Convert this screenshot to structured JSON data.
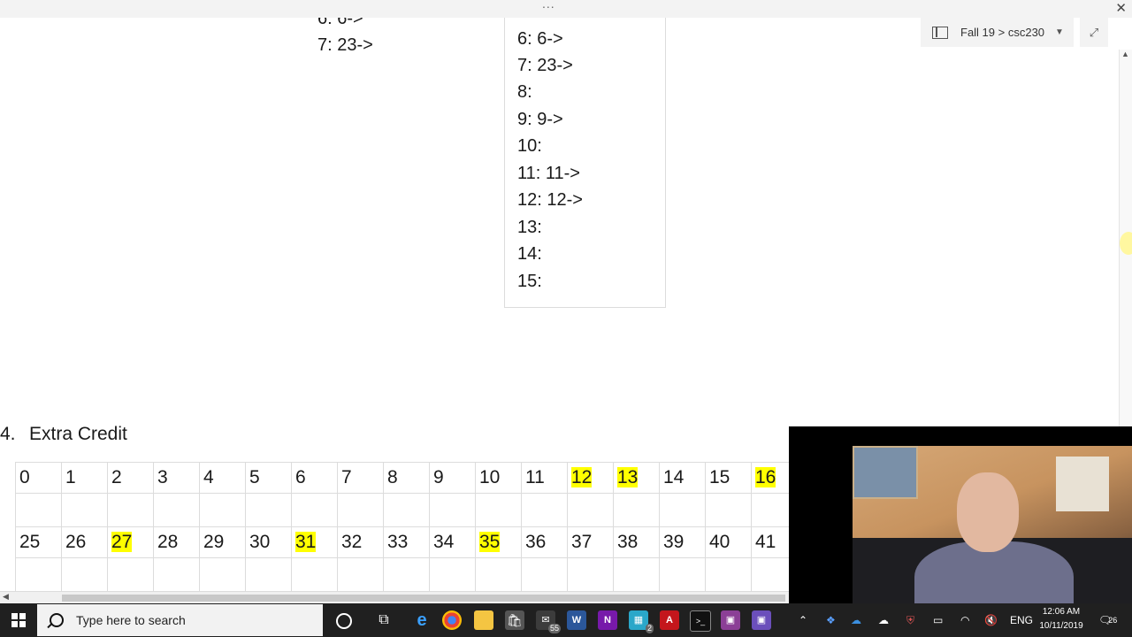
{
  "window": {
    "dots": "...",
    "close": "✕"
  },
  "breadcrumb": {
    "text": "Fall 19 > csc230",
    "expand": "⤢"
  },
  "left_column": [
    "6: 6->",
    "7: 23->"
  ],
  "hash_table": [
    "6: 6->",
    "7: 23->",
    "8:",
    "9: 9->",
    "10:",
    "11: 11->",
    "12: 12->",
    "13:",
    "14:",
    "15:"
  ],
  "section": {
    "number": "4.",
    "title": "Extra Credit"
  },
  "grid": {
    "row1": [
      {
        "v": "0",
        "hl": false
      },
      {
        "v": "1",
        "hl": false
      },
      {
        "v": "2",
        "hl": false
      },
      {
        "v": "3",
        "hl": false
      },
      {
        "v": "4",
        "hl": false
      },
      {
        "v": "5",
        "hl": false
      },
      {
        "v": "6",
        "hl": false
      },
      {
        "v": "7",
        "hl": false
      },
      {
        "v": "8",
        "hl": false
      },
      {
        "v": "9",
        "hl": false
      },
      {
        "v": "10",
        "hl": false
      },
      {
        "v": "11",
        "hl": false
      },
      {
        "v": "12",
        "hl": true
      },
      {
        "v": "13",
        "hl": true
      },
      {
        "v": "14",
        "hl": false
      },
      {
        "v": "15",
        "hl": false
      },
      {
        "v": "16",
        "hl": true
      }
    ],
    "row3": [
      {
        "v": "25",
        "hl": false
      },
      {
        "v": "26",
        "hl": false
      },
      {
        "v": "27",
        "hl": true
      },
      {
        "v": "28",
        "hl": false
      },
      {
        "v": "29",
        "hl": false
      },
      {
        "v": "30",
        "hl": false
      },
      {
        "v": "31",
        "hl": true
      },
      {
        "v": "32",
        "hl": false
      },
      {
        "v": "33",
        "hl": false
      },
      {
        "v": "34",
        "hl": false
      },
      {
        "v": "35",
        "hl": true
      },
      {
        "v": "36",
        "hl": false
      },
      {
        "v": "37",
        "hl": false
      },
      {
        "v": "38",
        "hl": false
      },
      {
        "v": "39",
        "hl": false
      },
      {
        "v": "40",
        "hl": false
      },
      {
        "v": "41",
        "hl": false
      }
    ],
    "highlight_color": "#ffff00"
  },
  "taskbar": {
    "search_placeholder": "Type here to search",
    "badge_mail": "55",
    "badge_app": "2",
    "tray_lang": "ENG",
    "time": "12:06 AM",
    "date": "10/11/2019",
    "notification_count": "26"
  },
  "icons": [
    "windows-logo-icon",
    "search-icon",
    "cortana-icon",
    "task-view-icon",
    "edge-icon",
    "chrome-icon",
    "file-explorer-icon",
    "store-icon",
    "mail-icon",
    "word-icon",
    "onenote-icon",
    "app-icon",
    "acrobat-icon",
    "terminal-icon",
    "teams-icon",
    "teams2-icon",
    "chevron-up-icon",
    "dropbox-icon",
    "onedrive-icon",
    "cloud-icon",
    "shield-icon",
    "battery-icon",
    "wifi-icon",
    "volume-icon",
    "notification-icon"
  ]
}
